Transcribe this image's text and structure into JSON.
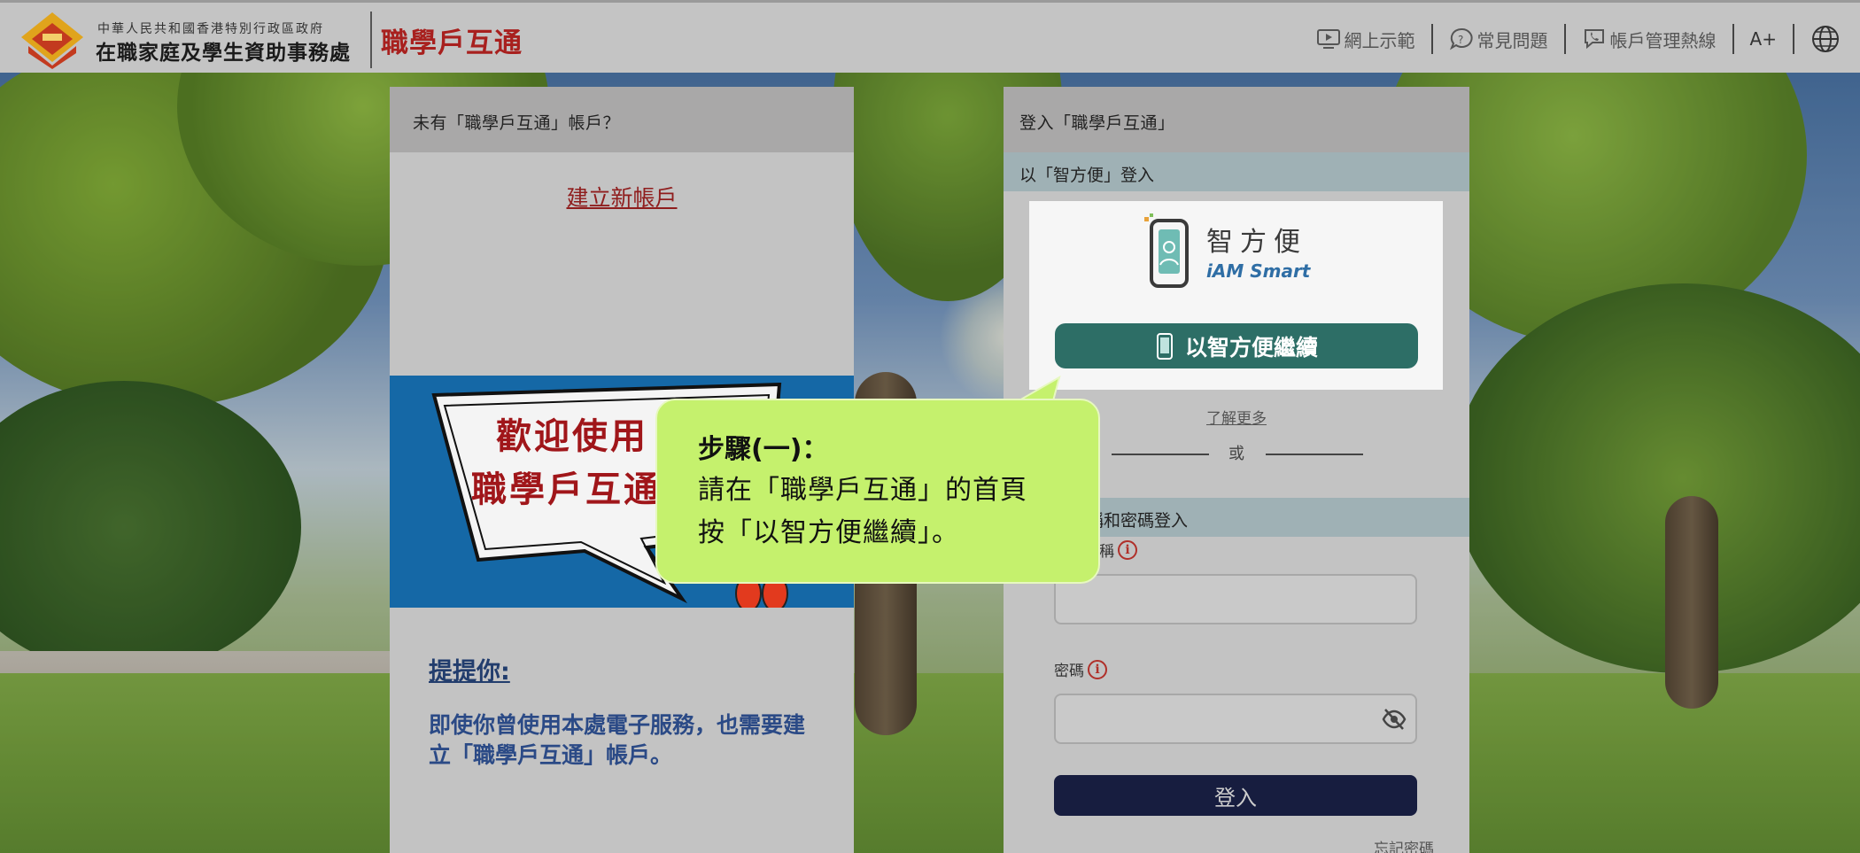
{
  "header": {
    "dept_small": "中華人民共和國香港特別行政區政府",
    "dept_big": "在職家庭及學生資助事務處",
    "brand": "職學戶互通",
    "nav": [
      {
        "label": "網上示範",
        "icon": "video-demo-icon"
      },
      {
        "label": "常見問題",
        "icon": "faq-chat-icon"
      },
      {
        "label": "帳戶管理熱線",
        "icon": "hotline-phone-icon"
      }
    ],
    "font_size_toggle": "A+",
    "language_icon": "globe-icon"
  },
  "left_card": {
    "title": "未有「職學戶互通」帳戶？",
    "create_link": "建立新帳戶",
    "banner": {
      "line1": "歡迎使用",
      "line2": "職學戶互通"
    },
    "reminder_title": "提提你:",
    "reminder_body": "即使你曾使用本處電子服務，也需要建立「職學戶互通」帳戶。"
  },
  "right_card": {
    "title": "登入「職學戶互通」",
    "iam_section": "以「智方便」登入",
    "iam_logo_cn": "智方便",
    "iam_logo_en": "iAM Smart",
    "iam_button": "以智方便繼續",
    "learn_more": "了解更多",
    "or_text": "或",
    "password_section": "以用戶名稱和密碼登入",
    "username_label": "用戶名稱",
    "password_label": "密碼",
    "login_button": "登入",
    "forgot_password": "忘記密碼"
  },
  "callout": {
    "title": "步驟(一)：",
    "line1": "請在「職學戶互通」的首頁",
    "line2": "按「以智方便繼續」。"
  },
  "colors": {
    "brand_red": "#a8201e",
    "iam_green": "#2d6e66",
    "login_navy": "#171d3f",
    "callout_green": "#c5f16d",
    "banner_blue": "#1568a6"
  }
}
